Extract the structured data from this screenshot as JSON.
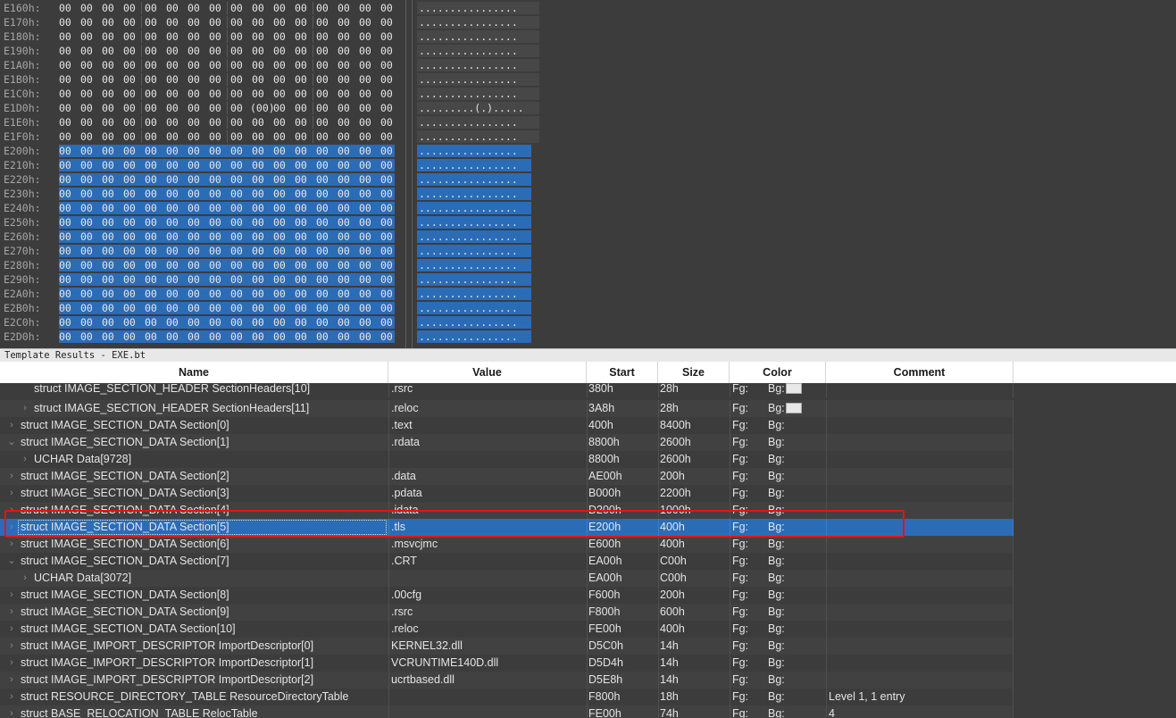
{
  "hex_view": {
    "rows": [
      {
        "address": "E160h:",
        "bytes": [
          "00",
          "00",
          "00",
          "00",
          "00",
          "00",
          "00",
          "00",
          "00",
          "00",
          "00",
          "00",
          "00",
          "00",
          "00",
          "00"
        ],
        "ascii": "................",
        "selected": false
      },
      {
        "address": "E170h:",
        "bytes": [
          "00",
          "00",
          "00",
          "00",
          "00",
          "00",
          "00",
          "00",
          "00",
          "00",
          "00",
          "00",
          "00",
          "00",
          "00",
          "00"
        ],
        "ascii": "................",
        "selected": false
      },
      {
        "address": "E180h:",
        "bytes": [
          "00",
          "00",
          "00",
          "00",
          "00",
          "00",
          "00",
          "00",
          "00",
          "00",
          "00",
          "00",
          "00",
          "00",
          "00",
          "00"
        ],
        "ascii": "................",
        "selected": false
      },
      {
        "address": "E190h:",
        "bytes": [
          "00",
          "00",
          "00",
          "00",
          "00",
          "00",
          "00",
          "00",
          "00",
          "00",
          "00",
          "00",
          "00",
          "00",
          "00",
          "00"
        ],
        "ascii": "................",
        "selected": false
      },
      {
        "address": "E1A0h:",
        "bytes": [
          "00",
          "00",
          "00",
          "00",
          "00",
          "00",
          "00",
          "00",
          "00",
          "00",
          "00",
          "00",
          "00",
          "00",
          "00",
          "00"
        ],
        "ascii": "................",
        "selected": false
      },
      {
        "address": "E1B0h:",
        "bytes": [
          "00",
          "00",
          "00",
          "00",
          "00",
          "00",
          "00",
          "00",
          "00",
          "00",
          "00",
          "00",
          "00",
          "00",
          "00",
          "00"
        ],
        "ascii": "................",
        "selected": false
      },
      {
        "address": "E1C0h:",
        "bytes": [
          "00",
          "00",
          "00",
          "00",
          "00",
          "00",
          "00",
          "00",
          "00",
          "00",
          "00",
          "00",
          "00",
          "00",
          "00",
          "00"
        ],
        "ascii": "................",
        "selected": false
      },
      {
        "address": "E1D0h:",
        "bytes": [
          "00",
          "00",
          "00",
          "00",
          "00",
          "00",
          "00",
          "00",
          "00",
          "(00)",
          "00",
          "00",
          "00",
          "00",
          "00",
          "00"
        ],
        "ascii": ".........(.).....",
        "selected": false
      },
      {
        "address": "E1E0h:",
        "bytes": [
          "00",
          "00",
          "00",
          "00",
          "00",
          "00",
          "00",
          "00",
          "00",
          "00",
          "00",
          "00",
          "00",
          "00",
          "00",
          "00"
        ],
        "ascii": "................",
        "selected": false
      },
      {
        "address": "E1F0h:",
        "bytes": [
          "00",
          "00",
          "00",
          "00",
          "00",
          "00",
          "00",
          "00",
          "00",
          "00",
          "00",
          "00",
          "00",
          "00",
          "00",
          "00"
        ],
        "ascii": "................",
        "selected": false
      },
      {
        "address": "E200h:",
        "bytes": [
          "00",
          "00",
          "00",
          "00",
          "00",
          "00",
          "00",
          "00",
          "00",
          "00",
          "00",
          "00",
          "00",
          "00",
          "00",
          "00"
        ],
        "ascii": "................",
        "selected": true
      },
      {
        "address": "E210h:",
        "bytes": [
          "00",
          "00",
          "00",
          "00",
          "00",
          "00",
          "00",
          "00",
          "00",
          "00",
          "00",
          "00",
          "00",
          "00",
          "00",
          "00"
        ],
        "ascii": "................",
        "selected": true
      },
      {
        "address": "E220h:",
        "bytes": [
          "00",
          "00",
          "00",
          "00",
          "00",
          "00",
          "00",
          "00",
          "00",
          "00",
          "00",
          "00",
          "00",
          "00",
          "00",
          "00"
        ],
        "ascii": "................",
        "selected": true
      },
      {
        "address": "E230h:",
        "bytes": [
          "00",
          "00",
          "00",
          "00",
          "00",
          "00",
          "00",
          "00",
          "00",
          "00",
          "00",
          "00",
          "00",
          "00",
          "00",
          "00"
        ],
        "ascii": "................",
        "selected": true
      },
      {
        "address": "E240h:",
        "bytes": [
          "00",
          "00",
          "00",
          "00",
          "00",
          "00",
          "00",
          "00",
          "00",
          "00",
          "00",
          "00",
          "00",
          "00",
          "00",
          "00"
        ],
        "ascii": "................",
        "selected": true
      },
      {
        "address": "E250h:",
        "bytes": [
          "00",
          "00",
          "00",
          "00",
          "00",
          "00",
          "00",
          "00",
          "00",
          "00",
          "00",
          "00",
          "00",
          "00",
          "00",
          "00"
        ],
        "ascii": "................",
        "selected": true
      },
      {
        "address": "E260h:",
        "bytes": [
          "00",
          "00",
          "00",
          "00",
          "00",
          "00",
          "00",
          "00",
          "00",
          "00",
          "00",
          "00",
          "00",
          "00",
          "00",
          "00"
        ],
        "ascii": "................",
        "selected": true
      },
      {
        "address": "E270h:",
        "bytes": [
          "00",
          "00",
          "00",
          "00",
          "00",
          "00",
          "00",
          "00",
          "00",
          "00",
          "00",
          "00",
          "00",
          "00",
          "00",
          "00"
        ],
        "ascii": "................",
        "selected": true
      },
      {
        "address": "E280h:",
        "bytes": [
          "00",
          "00",
          "00",
          "00",
          "00",
          "00",
          "00",
          "00",
          "00",
          "00",
          "00",
          "00",
          "00",
          "00",
          "00",
          "00"
        ],
        "ascii": "................",
        "selected": true
      },
      {
        "address": "E290h:",
        "bytes": [
          "00",
          "00",
          "00",
          "00",
          "00",
          "00",
          "00",
          "00",
          "00",
          "00",
          "00",
          "00",
          "00",
          "00",
          "00",
          "00"
        ],
        "ascii": "................",
        "selected": true
      },
      {
        "address": "E2A0h:",
        "bytes": [
          "00",
          "00",
          "00",
          "00",
          "00",
          "00",
          "00",
          "00",
          "00",
          "00",
          "00",
          "00",
          "00",
          "00",
          "00",
          "00"
        ],
        "ascii": "................",
        "selected": true
      },
      {
        "address": "E2B0h:",
        "bytes": [
          "00",
          "00",
          "00",
          "00",
          "00",
          "00",
          "00",
          "00",
          "00",
          "00",
          "00",
          "00",
          "00",
          "00",
          "00",
          "00"
        ],
        "ascii": "................",
        "selected": true
      },
      {
        "address": "E2C0h:",
        "bytes": [
          "00",
          "00",
          "00",
          "00",
          "00",
          "00",
          "00",
          "00",
          "00",
          "00",
          "00",
          "00",
          "00",
          "00",
          "00",
          "00"
        ],
        "ascii": "................",
        "selected": true
      },
      {
        "address": "E2D0h:",
        "bytes": [
          "00",
          "00",
          "00",
          "00",
          "00",
          "00",
          "00",
          "00",
          "00",
          "00",
          "00",
          "00",
          "00",
          "00",
          "00",
          "00"
        ],
        "ascii": "................",
        "selected": true
      }
    ]
  },
  "template_panel": {
    "title": "Template Results - EXE.bt",
    "columns": [
      "Name",
      "Value",
      "Start",
      "Size",
      "Color",
      "Comment"
    ],
    "rows": [
      {
        "indent": 1,
        "expander": "",
        "name": "struct IMAGE_SECTION_HEADER SectionHeaders[10]",
        "value": ".rsrc",
        "start": "380h",
        "size": "28h",
        "fg": "Fg:",
        "bg": "Bg:",
        "swatch": true,
        "comment": "",
        "selected": false
      },
      {
        "indent": 1,
        "expander": "›",
        "name": "struct IMAGE_SECTION_HEADER SectionHeaders[11]",
        "value": ".reloc",
        "start": "3A8h",
        "size": "28h",
        "fg": "Fg:",
        "bg": "Bg:",
        "swatch": true,
        "comment": "",
        "selected": false
      },
      {
        "indent": 0,
        "expander": "›",
        "name": "struct IMAGE_SECTION_DATA Section[0]",
        "value": ".text",
        "start": "400h",
        "size": "8400h",
        "fg": "Fg:",
        "bg": "Bg:",
        "swatch": false,
        "comment": "",
        "selected": false
      },
      {
        "indent": 0,
        "expander": "⌄",
        "name": "struct IMAGE_SECTION_DATA Section[1]",
        "value": ".rdata",
        "start": "8800h",
        "size": "2600h",
        "fg": "Fg:",
        "bg": "Bg:",
        "swatch": false,
        "comment": "",
        "selected": false
      },
      {
        "indent": 1,
        "expander": "›",
        "name": "UCHAR Data[9728]",
        "value": "",
        "start": "8800h",
        "size": "2600h",
        "fg": "Fg:",
        "bg": "Bg:",
        "swatch": false,
        "comment": "",
        "selected": false
      },
      {
        "indent": 0,
        "expander": "›",
        "name": "struct IMAGE_SECTION_DATA Section[2]",
        "value": ".data",
        "start": "AE00h",
        "size": "200h",
        "fg": "Fg:",
        "bg": "Bg:",
        "swatch": false,
        "comment": "",
        "selected": false
      },
      {
        "indent": 0,
        "expander": "›",
        "name": "struct IMAGE_SECTION_DATA Section[3]",
        "value": ".pdata",
        "start": "B000h",
        "size": "2200h",
        "fg": "Fg:",
        "bg": "Bg:",
        "swatch": false,
        "comment": "",
        "selected": false
      },
      {
        "indent": 0,
        "expander": "›",
        "name": "struct IMAGE_SECTION_DATA Section[4]",
        "value": ".idata",
        "start": "D200h",
        "size": "1000h",
        "fg": "Fg:",
        "bg": "Bg:",
        "swatch": false,
        "comment": "",
        "selected": false
      },
      {
        "indent": 0,
        "expander": "›",
        "name": "struct IMAGE_SECTION_DATA Section[5]",
        "value": ".tls",
        "start": "E200h",
        "size": "400h",
        "fg": "Fg:",
        "bg": "Bg:",
        "swatch": false,
        "comment": "",
        "selected": true
      },
      {
        "indent": 0,
        "expander": "›",
        "name": "struct IMAGE_SECTION_DATA Section[6]",
        "value": ".msvcjmc",
        "start": "E600h",
        "size": "400h",
        "fg": "Fg:",
        "bg": "Bg:",
        "swatch": false,
        "comment": "",
        "selected": false
      },
      {
        "indent": 0,
        "expander": "⌄",
        "name": "struct IMAGE_SECTION_DATA Section[7]",
        "value": ".CRT",
        "start": "EA00h",
        "size": "C00h",
        "fg": "Fg:",
        "bg": "Bg:",
        "swatch": false,
        "comment": "",
        "selected": false
      },
      {
        "indent": 1,
        "expander": "›",
        "name": "UCHAR Data[3072]",
        "value": "",
        "start": "EA00h",
        "size": "C00h",
        "fg": "Fg:",
        "bg": "Bg:",
        "swatch": false,
        "comment": "",
        "selected": false
      },
      {
        "indent": 0,
        "expander": "›",
        "name": "struct IMAGE_SECTION_DATA Section[8]",
        "value": ".00cfg",
        "start": "F600h",
        "size": "200h",
        "fg": "Fg:",
        "bg": "Bg:",
        "swatch": false,
        "comment": "",
        "selected": false
      },
      {
        "indent": 0,
        "expander": "›",
        "name": "struct IMAGE_SECTION_DATA Section[9]",
        "value": ".rsrc",
        "start": "F800h",
        "size": "600h",
        "fg": "Fg:",
        "bg": "Bg:",
        "swatch": false,
        "comment": "",
        "selected": false
      },
      {
        "indent": 0,
        "expander": "›",
        "name": "struct IMAGE_SECTION_DATA Section[10]",
        "value": ".reloc",
        "start": "FE00h",
        "size": "400h",
        "fg": "Fg:",
        "bg": "Bg:",
        "swatch": false,
        "comment": "",
        "selected": false
      },
      {
        "indent": 0,
        "expander": "›",
        "name": "struct IMAGE_IMPORT_DESCRIPTOR ImportDescriptor[0]",
        "value": "KERNEL32.dll",
        "start": "D5C0h",
        "size": "14h",
        "fg": "Fg:",
        "bg": "Bg:",
        "swatch": false,
        "comment": "",
        "selected": false
      },
      {
        "indent": 0,
        "expander": "›",
        "name": "struct IMAGE_IMPORT_DESCRIPTOR ImportDescriptor[1]",
        "value": "VCRUNTIME140D.dll",
        "start": "D5D4h",
        "size": "14h",
        "fg": "Fg:",
        "bg": "Bg:",
        "swatch": false,
        "comment": "",
        "selected": false
      },
      {
        "indent": 0,
        "expander": "›",
        "name": "struct IMAGE_IMPORT_DESCRIPTOR ImportDescriptor[2]",
        "value": "ucrtbased.dll",
        "start": "D5E8h",
        "size": "14h",
        "fg": "Fg:",
        "bg": "Bg:",
        "swatch": false,
        "comment": "",
        "selected": false
      },
      {
        "indent": 0,
        "expander": "›",
        "name": "struct RESOURCE_DIRECTORY_TABLE ResourceDirectoryTable",
        "value": "",
        "start": "F800h",
        "size": "18h",
        "fg": "Fg:",
        "bg": "Bg:",
        "swatch": false,
        "comment": "Level 1, 1 entry",
        "selected": false
      },
      {
        "indent": 0,
        "expander": "›",
        "name": "struct BASE_RELOCATION_TABLE RelocTable",
        "value": "",
        "start": "FE00h",
        "size": "74h",
        "fg": "Fg:",
        "bg": "Bg:",
        "swatch": false,
        "comment": "4",
        "selected": false
      }
    ]
  },
  "colors": {
    "background": "#3c3c3c",
    "selection": "#2b6cb7",
    "highlight_box": "#e0151a",
    "header_bg": "#ffffff"
  }
}
